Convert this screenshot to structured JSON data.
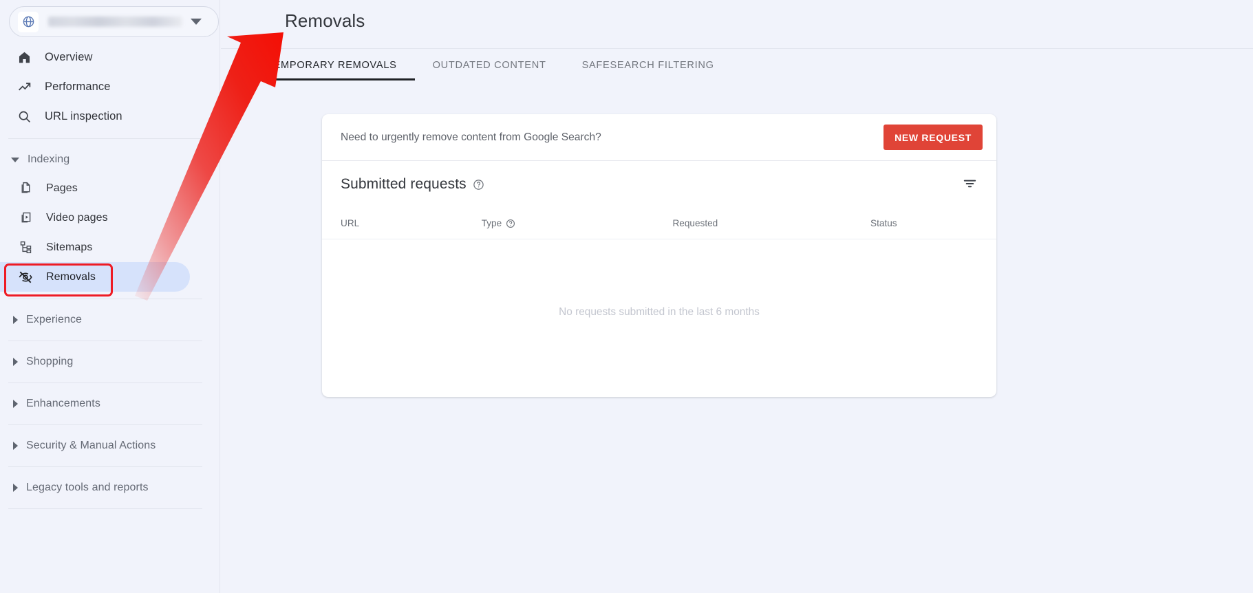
{
  "property_selector": {
    "icon": "globe-icon",
    "domain_value": "",
    "domain_masked": true,
    "caret": "chevron-down-icon"
  },
  "sidebar": {
    "top_items": [
      {
        "label": "Overview",
        "icon": "home-icon"
      },
      {
        "label": "Performance",
        "icon": "trending-up-icon"
      },
      {
        "label": "URL inspection",
        "icon": "search-icon"
      }
    ],
    "indexing_group": {
      "label": "Indexing",
      "expanded": true,
      "items": [
        {
          "label": "Pages",
          "icon": "pages-icon"
        },
        {
          "label": "Video pages",
          "icon": "video-pages-icon"
        },
        {
          "label": "Sitemaps",
          "icon": "sitemaps-icon"
        },
        {
          "label": "Removals",
          "icon": "eye-off-icon",
          "active": true
        }
      ]
    },
    "collapsed_groups": [
      {
        "label": "Experience"
      },
      {
        "label": "Shopping"
      },
      {
        "label": "Enhancements"
      },
      {
        "label": "Security & Manual Actions"
      },
      {
        "label": "Legacy tools and reports"
      }
    ]
  },
  "main": {
    "title": "Removals",
    "tabs": [
      {
        "label": "TEMPORARY REMOVALS",
        "active": true
      },
      {
        "label": "OUTDATED CONTENT",
        "active": false
      },
      {
        "label": "SAFESEARCH FILTERING",
        "active": false
      }
    ],
    "urgent": {
      "text": "Need to urgently remove content from Google Search?",
      "button_label": "NEW REQUEST"
    },
    "submitted": {
      "title": "Submitted requests",
      "help_icon": "help-circle-icon",
      "filter_icon": "filter-list-icon",
      "columns": [
        "URL",
        "Type",
        "Requested",
        "Status"
      ],
      "rows": [],
      "empty_message": "No requests submitted in the last 6 months"
    }
  },
  "annotations": {
    "highlight_target": "Removals",
    "highlight_color": "#ee1b24",
    "arrow_color": "#ee2b26",
    "arrow_from": "Removals sidebar item",
    "arrow_to": "Removals page title"
  },
  "colors": {
    "page_background": "#f1f3fb",
    "card_background": "#ffffff",
    "accent_button": "#e04437",
    "active_nav": "#d6e2fb",
    "annotation_red": "#ee1b24"
  }
}
